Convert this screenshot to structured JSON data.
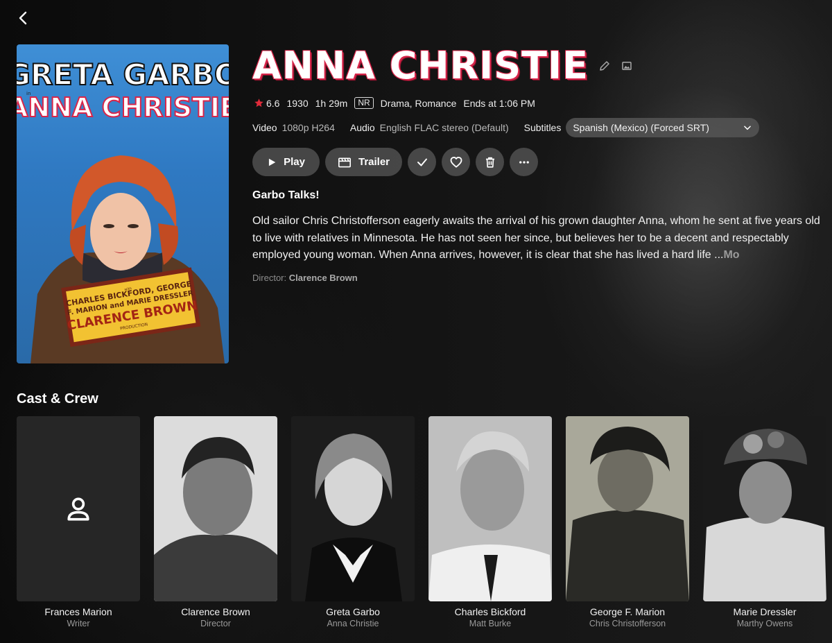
{
  "nav": {
    "back_icon": "chevron-left-icon"
  },
  "poster": {
    "top_text": "GRETA GARBO",
    "small_prefix": "in",
    "title_text": "ANNA CHRISTIE",
    "billing_prefix": "with",
    "billing_line1": "CHARLES BICKFORD, GEORGE",
    "billing_line2": "F. MARION and MARIE DRESSLER",
    "producer": "CLARENCE BROWN",
    "producer_suffix": "PRODUCTION"
  },
  "movie": {
    "title": "ANNA CHRISTIE",
    "rating": "6.6",
    "year": "1930",
    "runtime": "1h 29m",
    "certification": "NR",
    "genres": "Drama, Romance",
    "ends_at": "Ends at 1:06 PM",
    "video_label": "Video",
    "video_value": "1080p H264",
    "audio_label": "Audio",
    "audio_value": "English FLAC stereo (Default)",
    "subtitles_label": "Subtitles",
    "subtitles_value": "Spanish (Mexico) (Forced SRT)",
    "tagline": "Garbo Talks!",
    "overview": "Old sailor Chris Christofferson eagerly awaits the arrival of his grown daughter Anna, whom he sent at five years old to live with relatives in Minnesota. He has not seen her since, but believes her to be a decent and respectably employed young woman. When Anna arrives, however, it is clear that she has lived a hard life ...",
    "more_label": "Mo",
    "director_label": "Director:",
    "director_name": "Clarence Brown"
  },
  "actions": {
    "play_label": "Play",
    "trailer_label": "Trailer",
    "icons": [
      "play-icon",
      "film-icon",
      "check-icon",
      "heart-icon",
      "trash-icon",
      "more-icon",
      "pencil-icon",
      "image-icon",
      "star-icon",
      "chevron-down-icon",
      "person-icon"
    ]
  },
  "cast_section_title": "Cast & Crew",
  "cast": [
    {
      "name": "Frances Marion",
      "role": "Writer"
    },
    {
      "name": "Clarence Brown",
      "role": "Director"
    },
    {
      "name": "Greta Garbo",
      "role": "Anna Christie"
    },
    {
      "name": "Charles Bickford",
      "role": "Matt Burke"
    },
    {
      "name": "George F. Marion",
      "role": "Chris Christofferson"
    },
    {
      "name": "Marie Dressler",
      "role": "Marthy Owens"
    }
  ],
  "colors": {
    "accent_red": "#d8254a",
    "star_red": "#e02b3a",
    "button_bg": "#505050",
    "poster_blue": "#3f8fd6"
  }
}
